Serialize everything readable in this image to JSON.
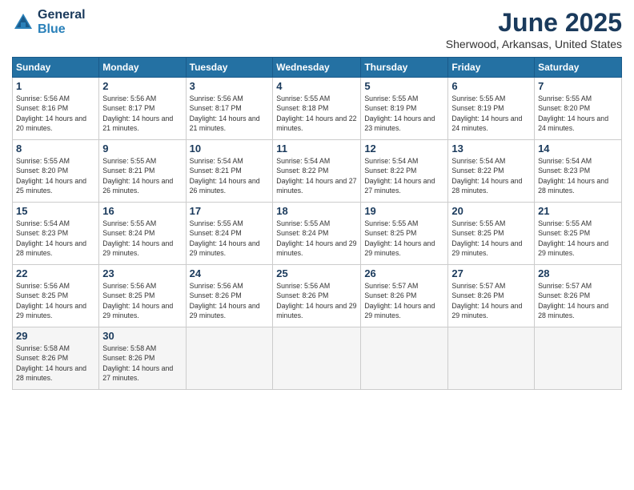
{
  "logo": {
    "general": "General",
    "blue": "Blue"
  },
  "title": "June 2025",
  "location": "Sherwood, Arkansas, United States",
  "days_of_week": [
    "Sunday",
    "Monday",
    "Tuesday",
    "Wednesday",
    "Thursday",
    "Friday",
    "Saturday"
  ],
  "weeks": [
    [
      {
        "day": "1",
        "sunrise": "Sunrise: 5:56 AM",
        "sunset": "Sunset: 8:16 PM",
        "daylight": "Daylight: 14 hours and 20 minutes."
      },
      {
        "day": "2",
        "sunrise": "Sunrise: 5:56 AM",
        "sunset": "Sunset: 8:17 PM",
        "daylight": "Daylight: 14 hours and 21 minutes."
      },
      {
        "day": "3",
        "sunrise": "Sunrise: 5:56 AM",
        "sunset": "Sunset: 8:17 PM",
        "daylight": "Daylight: 14 hours and 21 minutes."
      },
      {
        "day": "4",
        "sunrise": "Sunrise: 5:55 AM",
        "sunset": "Sunset: 8:18 PM",
        "daylight": "Daylight: 14 hours and 22 minutes."
      },
      {
        "day": "5",
        "sunrise": "Sunrise: 5:55 AM",
        "sunset": "Sunset: 8:19 PM",
        "daylight": "Daylight: 14 hours and 23 minutes."
      },
      {
        "day": "6",
        "sunrise": "Sunrise: 5:55 AM",
        "sunset": "Sunset: 8:19 PM",
        "daylight": "Daylight: 14 hours and 24 minutes."
      },
      {
        "day": "7",
        "sunrise": "Sunrise: 5:55 AM",
        "sunset": "Sunset: 8:20 PM",
        "daylight": "Daylight: 14 hours and 24 minutes."
      }
    ],
    [
      {
        "day": "8",
        "sunrise": "Sunrise: 5:55 AM",
        "sunset": "Sunset: 8:20 PM",
        "daylight": "Daylight: 14 hours and 25 minutes."
      },
      {
        "day": "9",
        "sunrise": "Sunrise: 5:55 AM",
        "sunset": "Sunset: 8:21 PM",
        "daylight": "Daylight: 14 hours and 26 minutes."
      },
      {
        "day": "10",
        "sunrise": "Sunrise: 5:54 AM",
        "sunset": "Sunset: 8:21 PM",
        "daylight": "Daylight: 14 hours and 26 minutes."
      },
      {
        "day": "11",
        "sunrise": "Sunrise: 5:54 AM",
        "sunset": "Sunset: 8:22 PM",
        "daylight": "Daylight: 14 hours and 27 minutes."
      },
      {
        "day": "12",
        "sunrise": "Sunrise: 5:54 AM",
        "sunset": "Sunset: 8:22 PM",
        "daylight": "Daylight: 14 hours and 27 minutes."
      },
      {
        "day": "13",
        "sunrise": "Sunrise: 5:54 AM",
        "sunset": "Sunset: 8:22 PM",
        "daylight": "Daylight: 14 hours and 28 minutes."
      },
      {
        "day": "14",
        "sunrise": "Sunrise: 5:54 AM",
        "sunset": "Sunset: 8:23 PM",
        "daylight": "Daylight: 14 hours and 28 minutes."
      }
    ],
    [
      {
        "day": "15",
        "sunrise": "Sunrise: 5:54 AM",
        "sunset": "Sunset: 8:23 PM",
        "daylight": "Daylight: 14 hours and 28 minutes."
      },
      {
        "day": "16",
        "sunrise": "Sunrise: 5:55 AM",
        "sunset": "Sunset: 8:24 PM",
        "daylight": "Daylight: 14 hours and 29 minutes."
      },
      {
        "day": "17",
        "sunrise": "Sunrise: 5:55 AM",
        "sunset": "Sunset: 8:24 PM",
        "daylight": "Daylight: 14 hours and 29 minutes."
      },
      {
        "day": "18",
        "sunrise": "Sunrise: 5:55 AM",
        "sunset": "Sunset: 8:24 PM",
        "daylight": "Daylight: 14 hours and 29 minutes."
      },
      {
        "day": "19",
        "sunrise": "Sunrise: 5:55 AM",
        "sunset": "Sunset: 8:25 PM",
        "daylight": "Daylight: 14 hours and 29 minutes."
      },
      {
        "day": "20",
        "sunrise": "Sunrise: 5:55 AM",
        "sunset": "Sunset: 8:25 PM",
        "daylight": "Daylight: 14 hours and 29 minutes."
      },
      {
        "day": "21",
        "sunrise": "Sunrise: 5:55 AM",
        "sunset": "Sunset: 8:25 PM",
        "daylight": "Daylight: 14 hours and 29 minutes."
      }
    ],
    [
      {
        "day": "22",
        "sunrise": "Sunrise: 5:56 AM",
        "sunset": "Sunset: 8:25 PM",
        "daylight": "Daylight: 14 hours and 29 minutes."
      },
      {
        "day": "23",
        "sunrise": "Sunrise: 5:56 AM",
        "sunset": "Sunset: 8:25 PM",
        "daylight": "Daylight: 14 hours and 29 minutes."
      },
      {
        "day": "24",
        "sunrise": "Sunrise: 5:56 AM",
        "sunset": "Sunset: 8:26 PM",
        "daylight": "Daylight: 14 hours and 29 minutes."
      },
      {
        "day": "25",
        "sunrise": "Sunrise: 5:56 AM",
        "sunset": "Sunset: 8:26 PM",
        "daylight": "Daylight: 14 hours and 29 minutes."
      },
      {
        "day": "26",
        "sunrise": "Sunrise: 5:57 AM",
        "sunset": "Sunset: 8:26 PM",
        "daylight": "Daylight: 14 hours and 29 minutes."
      },
      {
        "day": "27",
        "sunrise": "Sunrise: 5:57 AM",
        "sunset": "Sunset: 8:26 PM",
        "daylight": "Daylight: 14 hours and 29 minutes."
      },
      {
        "day": "28",
        "sunrise": "Sunrise: 5:57 AM",
        "sunset": "Sunset: 8:26 PM",
        "daylight": "Daylight: 14 hours and 28 minutes."
      }
    ],
    [
      {
        "day": "29",
        "sunrise": "Sunrise: 5:58 AM",
        "sunset": "Sunset: 8:26 PM",
        "daylight": "Daylight: 14 hours and 28 minutes."
      },
      {
        "day": "30",
        "sunrise": "Sunrise: 5:58 AM",
        "sunset": "Sunset: 8:26 PM",
        "daylight": "Daylight: 14 hours and 27 minutes."
      },
      null,
      null,
      null,
      null,
      null
    ]
  ]
}
